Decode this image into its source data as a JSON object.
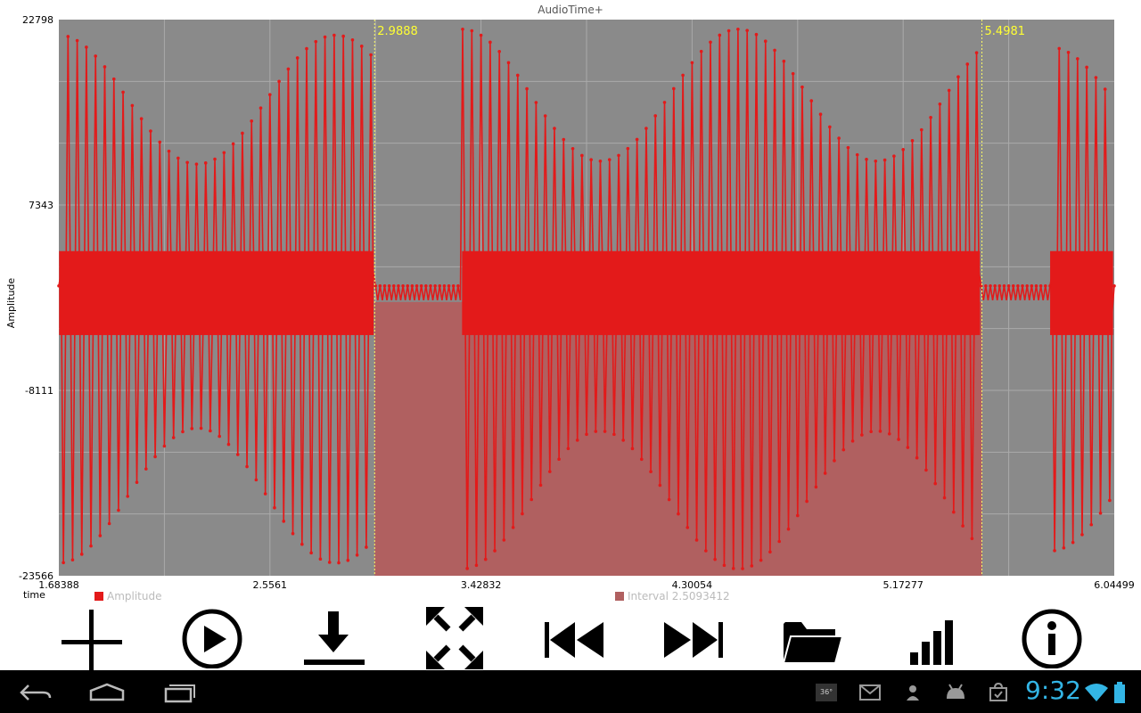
{
  "app": {
    "title": "AudioTime+"
  },
  "chart_data": {
    "type": "line",
    "title": "AudioTime+",
    "xlabel": "time",
    "ylabel": "Amplitude",
    "xlim": [
      1.68388,
      6.04499
    ],
    "ylim": [
      -23566,
      22798
    ],
    "x_ticks": [
      "1.68388",
      "2.5561",
      "3.42832",
      "4.30054",
      "5.17277",
      "6.04499"
    ],
    "y_ticks": [
      "22798",
      "7343",
      "-8111",
      "-23566"
    ],
    "grid": true,
    "legend_position": "bottom",
    "series": [
      {
        "name": "Amplitude",
        "color": "#e31a1a",
        "bursts": [
          {
            "start": 1.685,
            "end": 2.985,
            "peak": 21500,
            "trough": -22500
          },
          {
            "start": 3.35,
            "end": 5.49,
            "peak": 22000,
            "trough": -23000
          },
          {
            "start": 5.78,
            "end": 6.04,
            "peak": 20500,
            "trough": -21500
          }
        ],
        "quiet_level": 600
      }
    ],
    "interval": {
      "label": "Interval 2.5093412",
      "start": 2.9888,
      "end": 5.4981,
      "start_label": "2.9888",
      "end_label": "5.4981",
      "fill_color": "#b06060"
    },
    "legend": [
      {
        "label": "Amplitude",
        "color": "#e31a1a"
      },
      {
        "label": "Interval 2.5093412",
        "color": "#b06060"
      }
    ]
  },
  "toolbar": {
    "buttons": [
      {
        "name": "add",
        "icon": "plus-icon"
      },
      {
        "name": "play",
        "icon": "play-circle-icon"
      },
      {
        "name": "download",
        "icon": "download-icon"
      },
      {
        "name": "fullscreen",
        "icon": "expand-arrows-icon"
      },
      {
        "name": "rewind",
        "icon": "skip-back-icon"
      },
      {
        "name": "forward",
        "icon": "skip-forward-icon"
      },
      {
        "name": "open",
        "icon": "folder-icon"
      },
      {
        "name": "stats",
        "icon": "bar-chart-icon"
      },
      {
        "name": "info",
        "icon": "info-circle-icon"
      }
    ]
  },
  "system_bar": {
    "time": "9:32",
    "nav": [
      "back-icon",
      "home-icon",
      "recent-apps-icon"
    ],
    "status_icons": [
      "badge-icon",
      "gmail-icon",
      "download-status-icon",
      "android-icon",
      "store-icon",
      "wifi-icon",
      "battery-icon"
    ],
    "badge_text": "36°",
    "accent_color": "#33b5e5"
  }
}
